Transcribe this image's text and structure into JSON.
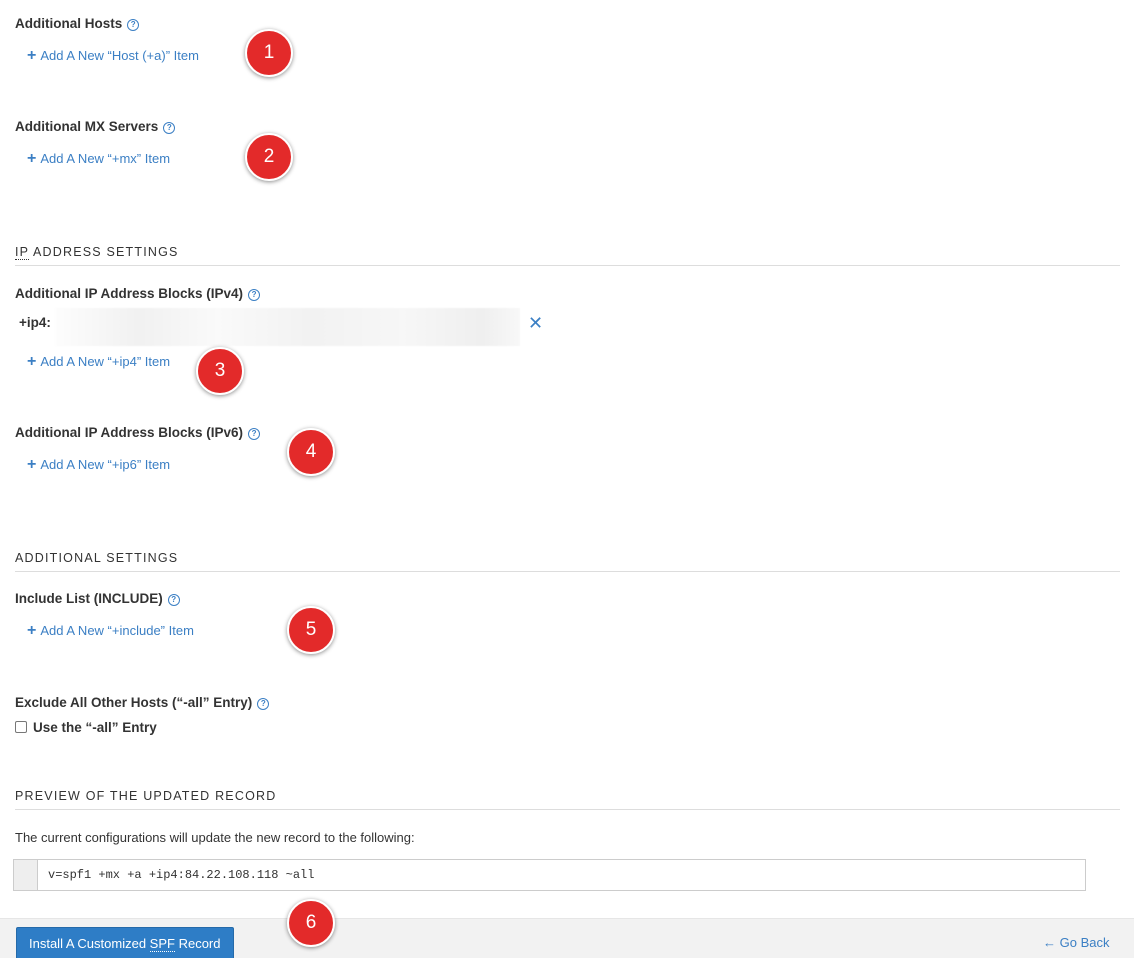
{
  "hosts": {
    "label": "Additional Hosts",
    "add_link": "Add A New “Host (+a)” Item"
  },
  "mx": {
    "label": "Additional MX Servers",
    "add_link": "Add A New “+mx” Item"
  },
  "ip_section": {
    "title_prefix": "IP",
    "title_rest": " ADDRESS SETTINGS"
  },
  "ipv4": {
    "label": "Additional IP Address Blocks (IPv4)",
    "entry_prefix": "+ip4:",
    "add_link": "Add A New “+ip4” Item"
  },
  "ipv6": {
    "label": "Additional IP Address Blocks (IPv6)",
    "add_link": "Add A New “+ip6” Item"
  },
  "additional_section": {
    "title": "ADDITIONAL SETTINGS"
  },
  "include": {
    "label": "Include List (INCLUDE)",
    "add_link": "Add A New “+include” Item"
  },
  "exclude": {
    "label": "Exclude All Other Hosts (“-all” Entry)",
    "checkbox_label": "Use the “-all” Entry",
    "checked": false
  },
  "preview": {
    "title": "PREVIEW OF THE UPDATED RECORD",
    "description": "The current configurations will update the new record to the following:",
    "record": "v=spf1 +mx +a +ip4:84.22.108.118 ~all"
  },
  "footer": {
    "install_prefix": "Install A Customized ",
    "install_abbr": "SPF",
    "install_suffix": " Record",
    "go_back": "Go Back"
  },
  "badges": [
    "1",
    "2",
    "3",
    "4",
    "5",
    "6"
  ],
  "icons": {
    "help": "question-circle-icon",
    "plus": "plus-icon",
    "remove": "close-icon",
    "back": "arrow-left-icon"
  },
  "colors": {
    "link": "#3b7fc4",
    "badge": "#e32a2a",
    "button": "#2e7dc6"
  }
}
